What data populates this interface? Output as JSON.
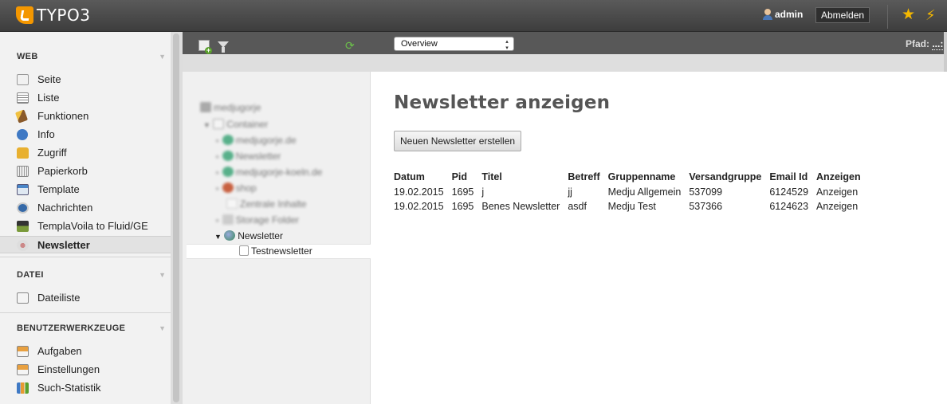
{
  "topbar": {
    "logo_text": "TYPO3",
    "username": "admin",
    "logout_label": "Abmelden"
  },
  "sidebar": {
    "groups": [
      {
        "label": "WEB",
        "items": [
          {
            "label": "Seite",
            "icon": "page-edit-icon"
          },
          {
            "label": "Liste",
            "icon": "list-icon"
          },
          {
            "label": "Funktionen",
            "icon": "wand-icon"
          },
          {
            "label": "Info",
            "icon": "info-icon"
          },
          {
            "label": "Zugriff",
            "icon": "lock-icon"
          },
          {
            "label": "Papierkorb",
            "icon": "trash-icon"
          },
          {
            "label": "Template",
            "icon": "template-icon"
          },
          {
            "label": "Nachrichten",
            "icon": "news-icon"
          },
          {
            "label": "TemplaVoila to Fluid/GE",
            "icon": "templavoila-icon"
          },
          {
            "label": "Newsletter",
            "icon": "newsletter-icon",
            "active": true
          }
        ]
      },
      {
        "label": "DATEI",
        "items": [
          {
            "label": "Dateiliste",
            "icon": "filelist-icon"
          }
        ]
      },
      {
        "label": "BENUTZERWERKZEUGE",
        "items": [
          {
            "label": "Aufgaben",
            "icon": "tasks-icon"
          },
          {
            "label": "Einstellungen",
            "icon": "settings-icon"
          },
          {
            "label": "Such-Statistik",
            "icon": "statistics-icon"
          }
        ]
      }
    ]
  },
  "docheader": {
    "function_select": "Overview",
    "path_label": "Pfad:",
    "path_value": "...:"
  },
  "tree": {
    "root": "medjugorje",
    "container": "Container",
    "blurred_items": [
      "medjugorje.de",
      "Newsletter",
      "medjugorje-koeln.de",
      "shop",
      "Zentrale Inhalte",
      "Storage Folder"
    ],
    "newsletter_folder": "Newsletter",
    "selected_page": "Testnewsletter"
  },
  "main": {
    "title": "Newsletter anzeigen",
    "create_button": "Neuen Newsletter erstellen",
    "columns": [
      "Datum",
      "Pid",
      "Titel",
      "Betreff",
      "Gruppenname",
      "Versandgruppe",
      "Email Id",
      "Anzeigen"
    ],
    "rows": [
      [
        "19.02.2015",
        "1695",
        "j",
        "jj",
        "Medju Allgemein",
        "537099",
        "6124529",
        "Anzeigen"
      ],
      [
        "19.02.2015",
        "1695",
        "Benes Newsletter",
        "asdf",
        "Medju Test",
        "537366",
        "6124623",
        "Anzeigen"
      ]
    ]
  },
  "colors": {
    "accent": "#f49700",
    "topbar": "#4a4a4a",
    "sidebar_bg": "#f2f2f2"
  }
}
